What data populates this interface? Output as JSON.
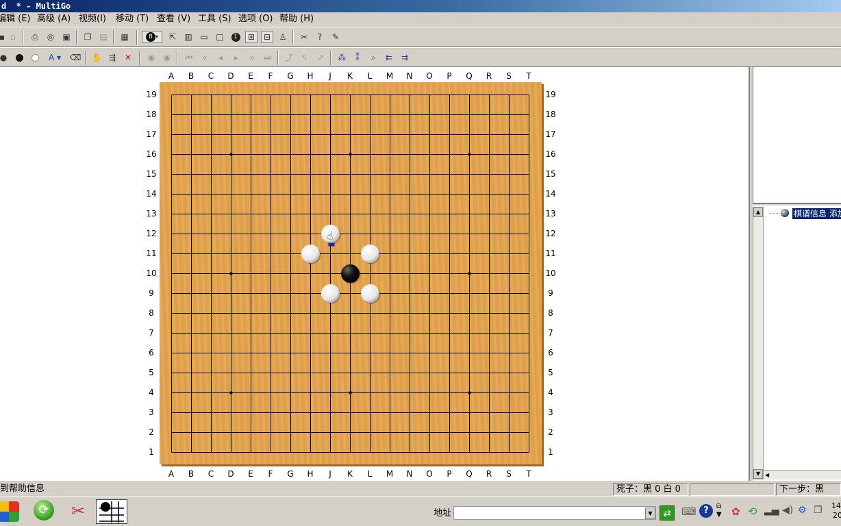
{
  "window": {
    "title": "d  * - MultiGo"
  },
  "menu": {
    "items": [
      "编辑 (E)",
      "高级 (A)",
      "视频(I)",
      "移动 (T)",
      "查看 (V)",
      "工具 (S)",
      "选项 (O)",
      "帮助 (H)"
    ]
  },
  "toolbar1": {
    "icons": [
      "save-icon",
      "print-preview-icon",
      "print-icon",
      "print-preview-icon",
      "image-export-icon",
      "copy-icon",
      "paste-icon",
      "properties-icon",
      "move-number-icon",
      "expand-icon",
      "view-full-icon",
      "view-split-v-icon",
      "view-split-h-icon",
      "view-none-icon",
      "number-icon",
      "tree-icon",
      "branch-icon",
      "hierarchy-icon",
      "tools-icon",
      "help-cursor-icon",
      "clear-icon"
    ],
    "number_badge": "8",
    "move_number": "1"
  },
  "toolbar2": {
    "icons": [
      "stone-pair-icon",
      "black-stone-icon",
      "white-stone-icon",
      "label-tool-icon",
      "eraser-icon",
      "hand-icon",
      "branch-add-icon",
      "delete-icon",
      "nav-play-icon",
      "nav-play-icon",
      "nav-first-icon",
      "nav-prev10-icon",
      "nav-prev-icon",
      "nav-next-icon",
      "nav-next10-icon",
      "nav-last-icon",
      "var-up-icon",
      "var-prev-icon",
      "var-next-icon",
      "find-icon",
      "find-icon",
      "search-icon",
      "search-prev-icon",
      "search-next-icon"
    ]
  },
  "board": {
    "columns": [
      "A",
      "B",
      "C",
      "D",
      "E",
      "F",
      "G",
      "H",
      "J",
      "K",
      "L",
      "M",
      "N",
      "O",
      "P",
      "Q",
      "R",
      "S",
      "T"
    ],
    "rows": [
      "19",
      "18",
      "17",
      "16",
      "15",
      "14",
      "13",
      "12",
      "11",
      "10",
      "9",
      "8",
      "7",
      "6",
      "5",
      "4",
      "3",
      "2",
      "1"
    ],
    "stones": [
      {
        "color": "black",
        "point": "K10"
      },
      {
        "color": "white",
        "point": "J12"
      },
      {
        "color": "white",
        "point": "H11"
      },
      {
        "color": "white",
        "point": "L11"
      },
      {
        "color": "white",
        "point": "J9"
      },
      {
        "color": "white",
        "point": "L9"
      }
    ],
    "last_move": "J12",
    "cursor_icon": "hand-cursor-icon"
  },
  "tree": {
    "node_label": "棋谱信息 添加"
  },
  "status": {
    "help": "到帮助信息",
    "captures": "死子：黑 0 白 0",
    "next_move": "下一步：黑"
  },
  "taskbar": {
    "address_label": "地址",
    "address_value": "",
    "clock": "14",
    "clock_sub": "20"
  },
  "colors": {
    "board": "#e4a34d",
    "title_start": "#0a246a",
    "selection": "#0a246a"
  }
}
